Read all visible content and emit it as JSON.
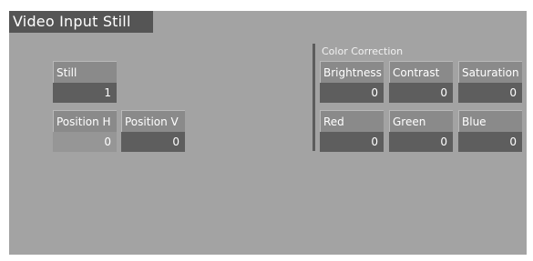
{
  "window": {
    "title": "Video Input Still"
  },
  "left_group": {
    "still": {
      "label": "Still",
      "value": "1"
    },
    "position_h": {
      "label": "Position H",
      "value": "0"
    },
    "position_v": {
      "label": "Position V",
      "value": "0"
    }
  },
  "color_correction": {
    "title": "Color Correction",
    "brightness": {
      "label": "Brightness",
      "value": "0"
    },
    "contrast": {
      "label": "Contrast",
      "value": "0"
    },
    "saturation": {
      "label": "Saturation",
      "value": "0"
    },
    "red": {
      "label": "Red",
      "value": "0"
    },
    "green": {
      "label": "Green",
      "value": "0"
    },
    "blue": {
      "label": "Blue",
      "value": "0"
    }
  }
}
